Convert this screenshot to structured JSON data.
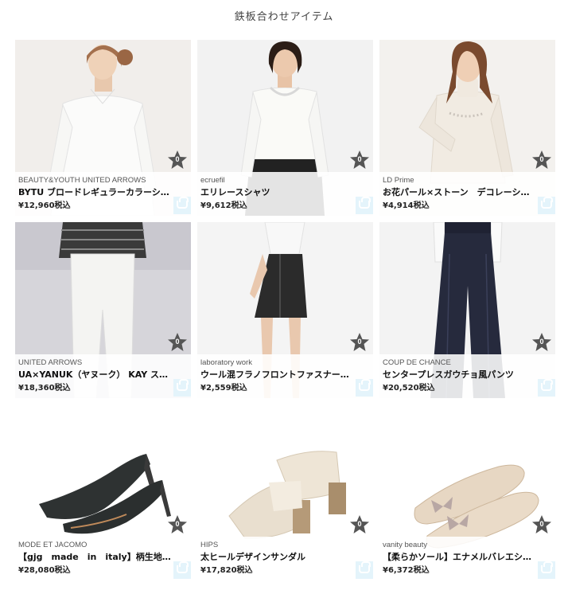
{
  "section_title": "鉄板合わせアイテム",
  "colors": {
    "star": "#555555",
    "cart_bg": "#e4f4fb",
    "card_bg": "#f4f4f4"
  },
  "items": [
    {
      "brand": "BEAUTY&YOUTH UNITED ARROWS",
      "name": "BYTU ブロードレギュラーカラーシャツ",
      "price": "¥12,960税込",
      "favorites": "0",
      "image": "white-shirt"
    },
    {
      "brand": "ecruefil",
      "name": "エリレースシャツ",
      "price": "¥9,612税込",
      "favorites": "0",
      "image": "lace-collar-shirt"
    },
    {
      "brand": "LD Prime",
      "name": "お花パール×ストーン　デコレーションリ…",
      "price": "¥4,914税込",
      "favorites": "0",
      "image": "turtleneck-knit"
    },
    {
      "brand": "UNITED ARROWS",
      "name": "UA×YANUK（ヤヌーク） KAY スリム …",
      "price": "¥18,360税込",
      "favorites": "0",
      "image": "white-pants"
    },
    {
      "brand": "laboratory work",
      "name": "ウール混フラノフロントファスナータイト…",
      "price": "¥2,559税込",
      "favorites": "0",
      "image": "tight-skirt"
    },
    {
      "brand": "COUP DE CHANCE",
      "name": "センタープレスガウチョ風パンツ",
      "price": "¥20,520税込",
      "favorites": "0",
      "image": "gaucho-pants"
    },
    {
      "brand": "MODE ET JACOMO",
      "name": "【gjg　made　in　italy】柄生地ヒール…",
      "price": "¥28,080税込",
      "favorites": "0",
      "image": "black-pumps"
    },
    {
      "brand": "HIPS",
      "name": "太ヒールデザインサンダル",
      "price": "¥17,820税込",
      "favorites": "0",
      "image": "beige-sandals"
    },
    {
      "brand": "vanity beauty",
      "name": "【柔らかソール】エナメルバレエシューズ",
      "price": "¥6,372税込",
      "favorites": "0",
      "image": "ballet-shoes"
    }
  ]
}
